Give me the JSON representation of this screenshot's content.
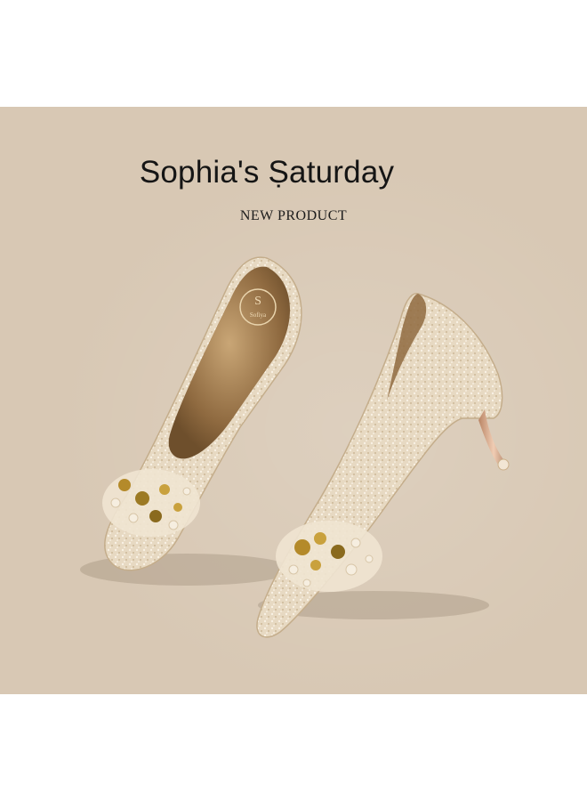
{
  "banner": {
    "title": "Sophia's Ṣaturday",
    "subtitle": "NEW PRODUCT",
    "insole_logo_text": "Sofiya",
    "insole_logo_letter": "S"
  },
  "colors": {
    "background": "#d8c8b4",
    "shoe_glitter": "#e9dcc6",
    "shoe_lining": "#9c7b52",
    "heel": "#c99a7c",
    "jewel_gold": "#b48a2a"
  },
  "image": {
    "subject": "pair of champagne glitter kitten-heel pumps with crystal brooch"
  }
}
